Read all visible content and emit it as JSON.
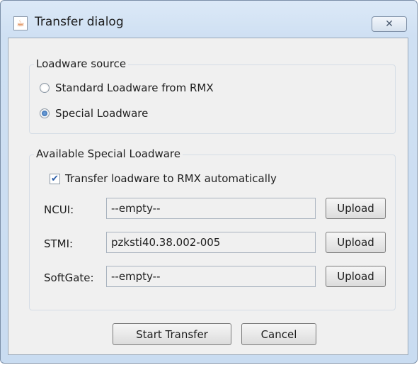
{
  "window": {
    "title": "Transfer dialog",
    "close_glyph": "✕"
  },
  "source_group": {
    "title": "Loadware source",
    "options": [
      {
        "label": "Standard Loadware from RMX",
        "checked": false
      },
      {
        "label": "Special Loadware",
        "checked": true
      }
    ]
  },
  "special_group": {
    "title": "Available Special Loadware",
    "auto_transfer": {
      "label": "Transfer loadware to RMX automatically",
      "checked": true
    },
    "rows": [
      {
        "label": "NCUI:",
        "value": "--empty--",
        "button": "Upload"
      },
      {
        "label": "STMI:",
        "value": "pzksti40.38.002-005",
        "button": "Upload"
      },
      {
        "label": "SoftGate:",
        "value": "--empty--",
        "button": "Upload"
      }
    ]
  },
  "footer": {
    "start_label": "Start Transfer",
    "cancel_label": "Cancel"
  },
  "icons": {
    "app": "java-app-icon",
    "close": "close-icon"
  },
  "colors": {
    "accent": "#2a5da8",
    "titlebar": "#cfe0f3",
    "panel": "#f0f0f0"
  }
}
